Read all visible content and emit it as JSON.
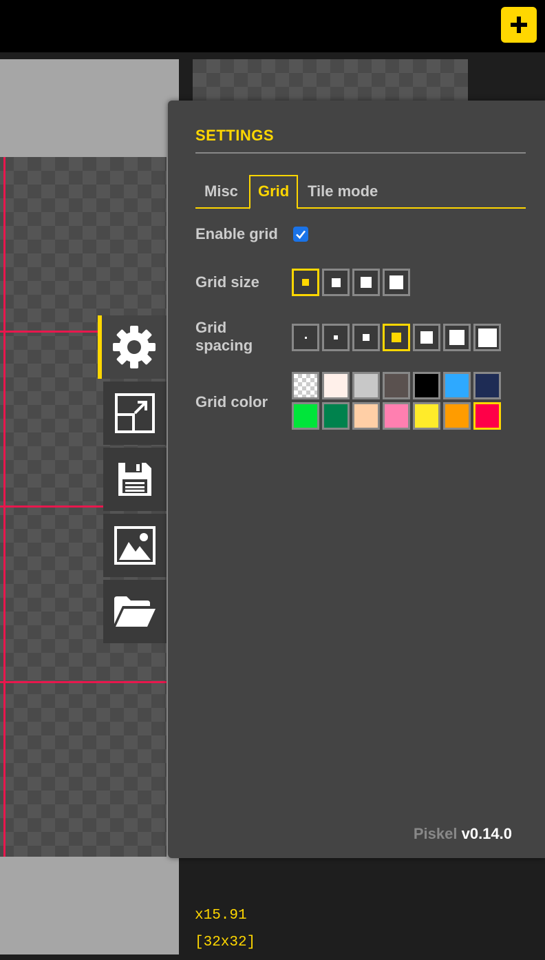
{
  "topbar": {
    "new_button_icon": "plus-icon",
    "accent_color": "#ffd700"
  },
  "settings": {
    "title": "SETTINGS",
    "tabs": [
      {
        "label": "Misc",
        "active": false
      },
      {
        "label": "Grid",
        "active": true
      },
      {
        "label": "Tile mode",
        "active": false
      }
    ],
    "enable_grid": {
      "label": "Enable grid",
      "checked": true
    },
    "grid_size": {
      "label": "Grid size",
      "options": 4,
      "selected_index": 0
    },
    "grid_spacing": {
      "label_line1": "Grid",
      "label_line2": "spacing",
      "options": 7,
      "selected_index": 3
    },
    "grid_color": {
      "label": "Grid color",
      "swatches": [
        "transparent",
        "#fff0ea",
        "#c8c8c8",
        "#5a514f",
        "#000000",
        "#2ea9ff",
        "#1e2c55",
        "#00e53a",
        "#00824d",
        "#ffcfa6",
        "#ff7fb0",
        "#ffeb2a",
        "#ff9c00",
        "#ff0048"
      ],
      "selected_index": 13
    },
    "app_name": "Piskel",
    "version": "v0.14.0"
  },
  "side_toolbar": [
    {
      "icon": "gear-icon",
      "active": true
    },
    {
      "icon": "resize-icon",
      "active": false
    },
    {
      "icon": "save-icon",
      "active": false
    },
    {
      "icon": "image-export-icon",
      "active": false
    },
    {
      "icon": "folder-open-icon",
      "active": false
    }
  ],
  "status": {
    "zoom": "x15.91",
    "size": "[32x32]"
  },
  "grid_line_color": "#e8174d"
}
